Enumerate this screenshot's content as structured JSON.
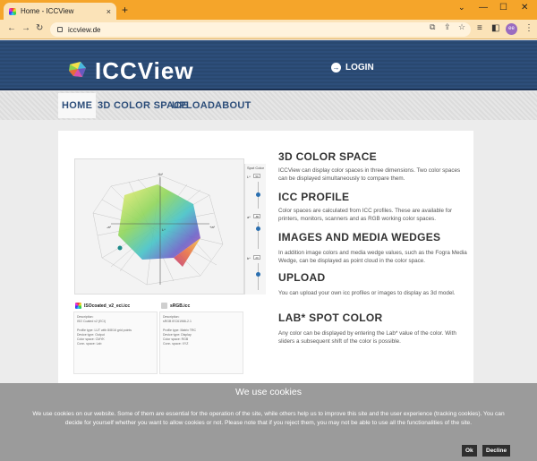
{
  "browser": {
    "tab_title": "Home - ICCView",
    "tab_close": "×",
    "new_tab": "+",
    "url": "iccview.de",
    "avatar_initials": "ee",
    "controls": {
      "back": "←",
      "forward": "→",
      "reload": "↻",
      "minimize": "—",
      "maximize": "☐",
      "close": "✕",
      "dropdown": "⌄"
    }
  },
  "header": {
    "logo_text": "ICCView",
    "login_label": "LOGIN",
    "login_icon": "→"
  },
  "nav": {
    "items": [
      {
        "label": "HOME",
        "active": true
      },
      {
        "label": "3D COLOR SPACE",
        "active": false
      },
      {
        "label": "UPLOAD",
        "active": false
      },
      {
        "label": "ABOUT",
        "active": false
      }
    ]
  },
  "viewer": {
    "axis_labels": {
      "b_plus": "+b*",
      "a_minus": "-a*",
      "a_plus": "+a*",
      "L": "L*"
    },
    "spot_color": {
      "title": "Spot Color",
      "L": {
        "label": "L*",
        "value": "50"
      },
      "a": {
        "label": "a*",
        "value": "-80"
      },
      "b": {
        "label": "b*",
        "value": "20"
      }
    },
    "profiles": [
      {
        "name": "ISOcoated_v2_eci.icc",
        "lines": [
          "Description:",
          "ISO Coated v2 (ECI)",
          "",
          "Profile type:    LUT with 8/8/16 grid points",
          "Device type:     Output",
          "Color space:     CMYK",
          "Conn. space:     Lab",
          "Created:         ",
          "Date:            "
        ]
      },
      {
        "name": "sRGB.icc",
        "lines": [
          "Description:",
          "sRGB IEC61966-2.1",
          "",
          "Profile type:    Matrix TRC",
          "Device type:     Display",
          "Color space:     RGB",
          "Conn. space:     XYZ",
          "Created:         ",
          "Date:            "
        ]
      }
    ]
  },
  "sections": [
    {
      "title": "3D COLOR SPACE",
      "text": "ICCView can display color spaces in three dimensions. Two color spaces can be displayed simultaneously to compare them."
    },
    {
      "title": "ICC PROFILE",
      "text": "Color spaces are calculated from ICC profiles. These are available for printers, monitors, scanners and as RGB working color spaces."
    },
    {
      "title": "IMAGES AND MEDIA WEDGES",
      "text": "In addition image colors and media wedge values, such as the Fogra Media Wedge, can be displayed as point cloud in the color space."
    },
    {
      "title": "UPLOAD",
      "text": "You can upload your own icc profiles or images to display as 3d model."
    },
    {
      "title": "LAB* SPOT COLOR",
      "text": "Any color can be displayed by entering the Lab* value of the color. With sliders a subsequent shift of the color is possible."
    }
  ],
  "cookie": {
    "title": "We use cookies",
    "text": "We use cookies on our website. Some of them are essential for the operation of the site, while others help us to improve this site and the user experience (tracking cookies). You can decide for yourself whether you want to allow cookies or not. Please note that if you reject them, you may not be able to use all the functionalities of the site.",
    "ok_label": "Ok",
    "decline_label": "Decline"
  }
}
